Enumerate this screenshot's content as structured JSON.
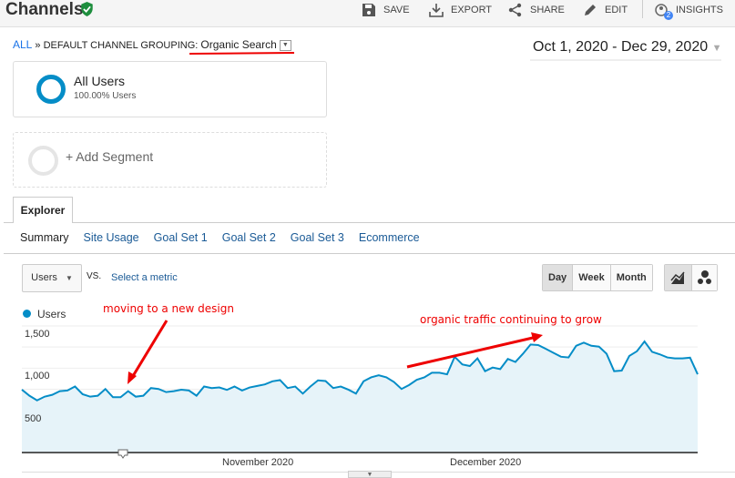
{
  "header": {
    "title": "Channels",
    "actions": [
      {
        "label": "SAVE",
        "icon": "save-icon"
      },
      {
        "label": "EXPORT",
        "icon": "export-icon"
      },
      {
        "label": "SHARE",
        "icon": "share-icon"
      },
      {
        "label": "EDIT",
        "icon": "pencil-icon"
      },
      {
        "label": "INSIGHTS",
        "icon": "insights-icon",
        "badge": "2"
      }
    ]
  },
  "breadcrumb": {
    "root": "ALL",
    "sep": "»",
    "label": "DEFAULT CHANNEL GROUPING:",
    "value": "Organic Search"
  },
  "date_range": "Oct 1, 2020 - Dec 29, 2020",
  "segments": {
    "active": {
      "name": "All Users",
      "detail": "100.00% Users"
    },
    "add": "+ Add Segment"
  },
  "explorer": {
    "tab": "Explorer",
    "subtabs": [
      "Summary",
      "Site Usage",
      "Goal Set 1",
      "Goal Set 2",
      "Goal Set 3",
      "Ecommerce"
    ]
  },
  "controls": {
    "metric": "Users",
    "vs": "VS.",
    "select_metric": "Select a metric",
    "periods": [
      "Day",
      "Week",
      "Month"
    ],
    "active_period": "Day"
  },
  "annotations": [
    "moving to a new design",
    "organic traffic continuing to grow"
  ],
  "colors": {
    "line": "#058dc7",
    "fill": "#e6f3f9",
    "annotation": "#ee0000",
    "link": "#1a5a96"
  },
  "chart_data": {
    "type": "area",
    "series": [
      {
        "name": "Users",
        "values": [
          745,
          673,
          618,
          662,
          684,
          727,
          735,
          782,
          691,
          662,
          673,
          753,
          655,
          655,
          727,
          662,
          673,
          764,
          753,
          716,
          727,
          745,
          735,
          673,
          782,
          764,
          771,
          742,
          782,
          735,
          771,
          789,
          807,
          844,
          858,
          764,
          782,
          698,
          782,
          855,
          847,
          764,
          782,
          745,
          698,
          844,
          891,
          916,
          891,
          836,
          753,
          800,
          862,
          891,
          945,
          945,
          927,
          1135,
          1044,
          1025,
          1116,
          964,
          1007,
          989,
          1109,
          1073,
          1171,
          1280,
          1273,
          1229,
          1182,
          1135,
          1127,
          1265,
          1302,
          1265,
          1255,
          1171,
          964,
          971,
          1145,
          1200,
          1316,
          1193,
          1164,
          1127,
          1116,
          1116,
          1124,
          927
        ]
      }
    ],
    "x_range": [
      "2020-10-01",
      "2020-12-29"
    ],
    "x_ticks": [
      "November 2020",
      "December 2020"
    ],
    "y_ticks": [
      "500",
      "1,000",
      "1,500"
    ],
    "ylim": [
      0,
      1500
    ],
    "grid": true,
    "legend": "top-left"
  }
}
